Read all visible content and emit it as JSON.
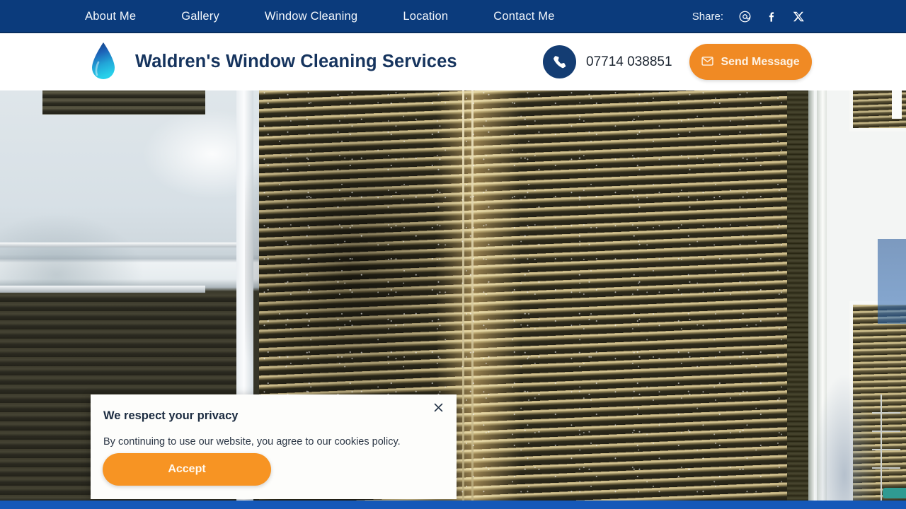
{
  "topbar": {
    "nav": [
      {
        "label": "About Me",
        "name": "nav-about-me"
      },
      {
        "label": "Gallery",
        "name": "nav-gallery"
      },
      {
        "label": "Window Cleaning",
        "name": "nav-window-cleaning"
      },
      {
        "label": "Location",
        "name": "nav-location"
      },
      {
        "label": "Contact Me",
        "name": "nav-contact-me"
      }
    ],
    "share_label": "Share:",
    "share_icons": [
      {
        "name": "email-share-icon",
        "glyph": "@"
      },
      {
        "name": "facebook-share-icon",
        "glyph": "f"
      },
      {
        "name": "x-twitter-share-icon",
        "glyph": "X"
      }
    ],
    "background_color": "#0b3b7c"
  },
  "header": {
    "logo_name": "water-droplet-logo",
    "title": "Waldren's Window Cleaning Services",
    "title_color": "#16345e",
    "phone": "07714 038851",
    "phone_icon_name": "phone-icon",
    "send_message_label": "Send Message",
    "send_message_icon_name": "envelope-icon",
    "accent_color": "#f08a24",
    "background_color": "#ffffff"
  },
  "hero": {
    "name": "hero-photo",
    "description": "Photo of windows with venetian blinds viewed from outside, water droplets on the glass"
  },
  "cookie_banner": {
    "title": "We respect your privacy",
    "text": "By continuing to use our website, you agree to our cookies policy.",
    "accept_label": "Accept",
    "close_icon_name": "close-icon",
    "accept_color": "#f79423",
    "background_color": "#fdfdfb"
  },
  "footer_strip": {
    "color": "#1558b8"
  }
}
